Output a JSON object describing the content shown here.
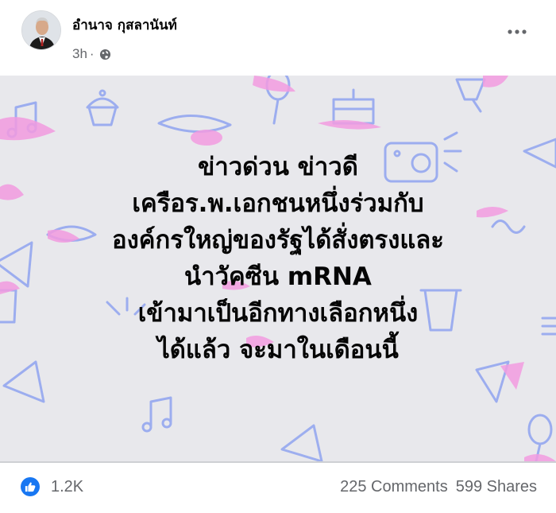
{
  "post": {
    "author": "อำนาจ กุสลานันท์",
    "time": "3h",
    "separator": "·",
    "privacy_icon": "globe-icon",
    "more_icon": "more-dots-icon",
    "text_lines": [
      "ข่าวด่วน ข่าวดี",
      "เครือร.พ.เอกชนหนึ่งร่วมกับ",
      "องค์กรใหญ่ของรัฐได้สั่งตรงและ",
      "นำวัคซีน mRNA",
      "เข้ามาเป็นอีกทางเลือกหนึ่ง",
      "ได้แล้ว จะมาในเดือนนี้"
    ],
    "background_color": "#e8e8ec"
  },
  "footer": {
    "reaction_icon": "like-icon",
    "reaction_count": "1.2K",
    "comments": "225 Comments",
    "shares": "599 Shares"
  },
  "colors": {
    "accent": "#1877f2",
    "pattern_pink": "#f29be0",
    "pattern_blue": "#8fa3f0"
  }
}
